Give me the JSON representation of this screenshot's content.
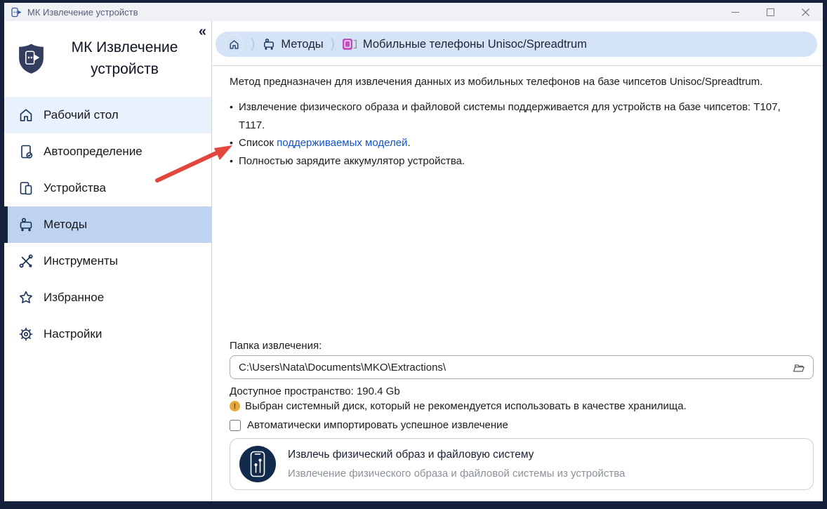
{
  "window": {
    "title": "МК Извлечение устройств",
    "controls": {
      "minimize": "minimize-button",
      "maximize": "maximize-button",
      "close": "close-button"
    }
  },
  "sidebar": {
    "app_title_line1": "МК Извлечение",
    "app_title_line2": "устройств",
    "collapse_glyph": "«",
    "items": [
      {
        "label": "Рабочий стол",
        "icon": "home-icon",
        "state": "highlight"
      },
      {
        "label": "Автоопределение",
        "icon": "autodetect-icon",
        "state": "normal"
      },
      {
        "label": "Устройства",
        "icon": "devices-icon",
        "state": "normal"
      },
      {
        "label": "Методы",
        "icon": "methods-icon",
        "state": "selected"
      },
      {
        "label": "Инструменты",
        "icon": "tools-icon",
        "state": "normal"
      },
      {
        "label": "Избранное",
        "icon": "star-icon",
        "state": "normal"
      },
      {
        "label": "Настройки",
        "icon": "gear-icon",
        "state": "normal"
      }
    ]
  },
  "breadcrumb": {
    "separator": ")",
    "methods_label": "Методы",
    "page_label": "Мобильные телефоны Unisoc/Spreadtrum",
    "icons": [
      "home-icon",
      "methods-icon",
      "mobile-phone-icon"
    ]
  },
  "content": {
    "description": "Метод предназначен для извлечения данных из мобильных телефонов на базе чипсетов Unisoc/Spreadtrum.",
    "bullet1": "Извлечение физического образа и файловой системы поддерживается для устройств на базе чипсетов: T107, Т117.",
    "bullet_mark": "•",
    "bullet2_prefix": "Список ",
    "bullet2_link": "поддерживаемых моделей",
    "bullet2_suffix": ".",
    "bullet3": "Полностью зарядите аккумулятор устройства.",
    "folder_label": "Папка извлечения:",
    "folder_path": "C:\\Users\\Nata\\Documents\\MKO\\Extractions\\",
    "space_text": "Доступное пространство: 190.4 Gb",
    "warning_glyph": "!",
    "warning_text": "Выбран системный диск, который не рекомендуется использовать в качестве хранилища.",
    "checkbox_label": "Автоматически импортировать успешное извлечение",
    "checkbox_checked": false,
    "action_card": {
      "title": "Извлечь физический образ и файловую систему",
      "subtitle": "Извлечение физического образа и файловой системы из устройства"
    }
  },
  "annotation": {
    "type": "red-arrow",
    "color": "#e2473d",
    "points_at": "supported-models-link"
  },
  "colors": {
    "frame": "#15203a",
    "titlebar_bg": "#f0f1f4",
    "sidebar_selected_bg": "#bdd3ef",
    "sidebar_highlight_bg": "#e9f1fc",
    "selected_accent": "#15233f",
    "breadcrumb_bg": "#d4e3f6",
    "icon_navy": "#183157",
    "link": "#1254cc",
    "warning": "#e9a83c",
    "pink_icon": "#c24ec2",
    "card_icon_bg": "#122a4c"
  }
}
